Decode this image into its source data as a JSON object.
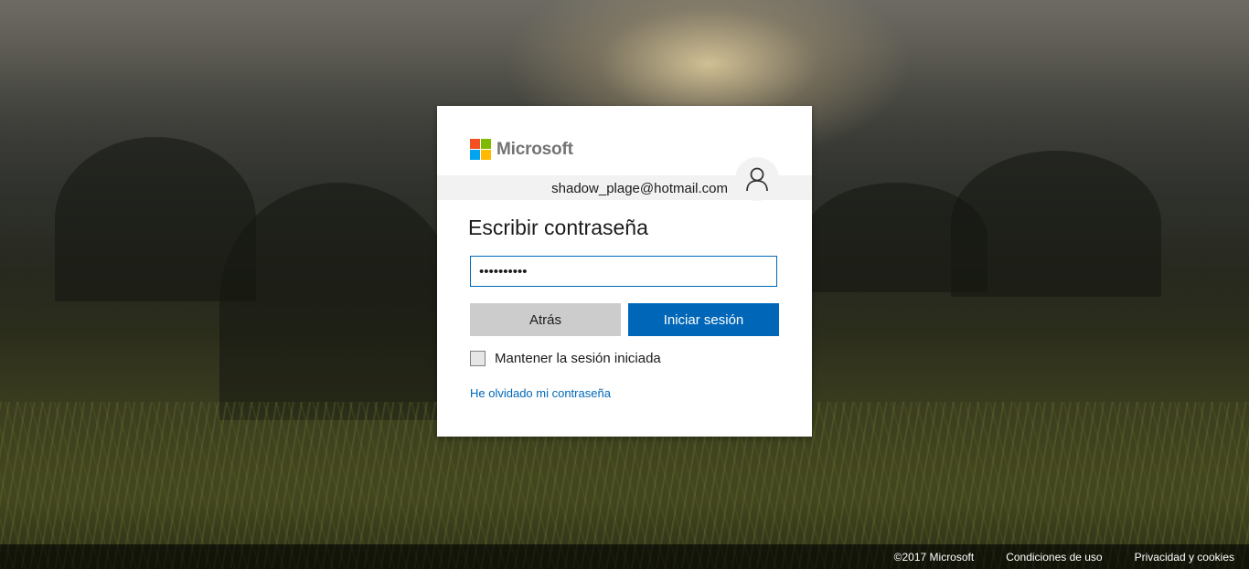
{
  "brand": {
    "name": "Microsoft",
    "logo_colors": [
      "#f25022",
      "#7fba00",
      "#00a4ef",
      "#ffb900"
    ]
  },
  "identity": {
    "email": "shadow_plage@hotmail.com",
    "avatar_icon": "user-icon"
  },
  "form": {
    "title": "Escribir contraseña",
    "password_value": "••••••••••",
    "back_label": "Atrás",
    "signin_label": "Iniciar sesión",
    "keep_signed_in_label": "Mantener la sesión iniciada",
    "forgot_label": "He olvidado mi contraseña"
  },
  "footer": {
    "copyright": "©2017 Microsoft",
    "terms": "Condiciones de uso",
    "privacy": "Privacidad y cookies"
  },
  "colors": {
    "accent": "#0067b8",
    "secondary_button": "#cccccc"
  }
}
